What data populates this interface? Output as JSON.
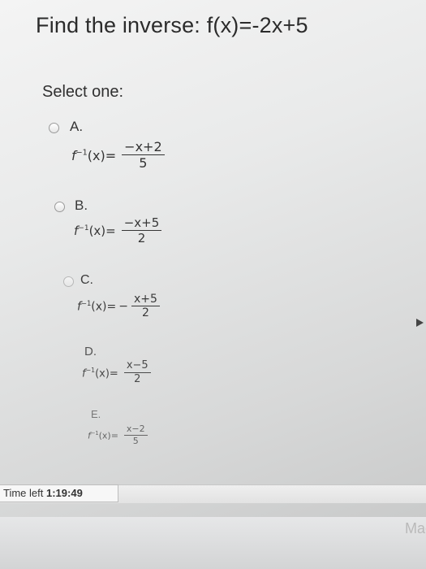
{
  "question": {
    "title": "Find the inverse:  f(x)=-2x+5"
  },
  "prompt": {
    "select_label": "Select one:"
  },
  "options": [
    {
      "letter": "A.",
      "lhs": "f",
      "sup": "−1",
      "arg": "(x)=",
      "neg": "",
      "numerator": "−x+2",
      "denominator": "5"
    },
    {
      "letter": "B.",
      "lhs": "f",
      "sup": "−1",
      "arg": "(x)=",
      "neg": "",
      "numerator": "−x+5",
      "denominator": "2"
    },
    {
      "letter": "C.",
      "lhs": "f",
      "sup": "−1",
      "arg": "(x)=",
      "neg": "−",
      "numerator": "x+5",
      "denominator": "2"
    },
    {
      "letter": "D.",
      "lhs": "f",
      "sup": "−1",
      "arg": "(x)=",
      "neg": "",
      "numerator": "x−5",
      "denominator": "2"
    },
    {
      "letter": "E.",
      "lhs": "f",
      "sup": "−1",
      "arg": "(x)=",
      "neg": "",
      "numerator": "x−2",
      "denominator": "5"
    }
  ],
  "timer": {
    "label": "Time left",
    "value": "1:19:49"
  },
  "device": {
    "brand": "Mac"
  },
  "colors": {
    "background": "#e9eaea",
    "text": "#2a2a2a"
  }
}
